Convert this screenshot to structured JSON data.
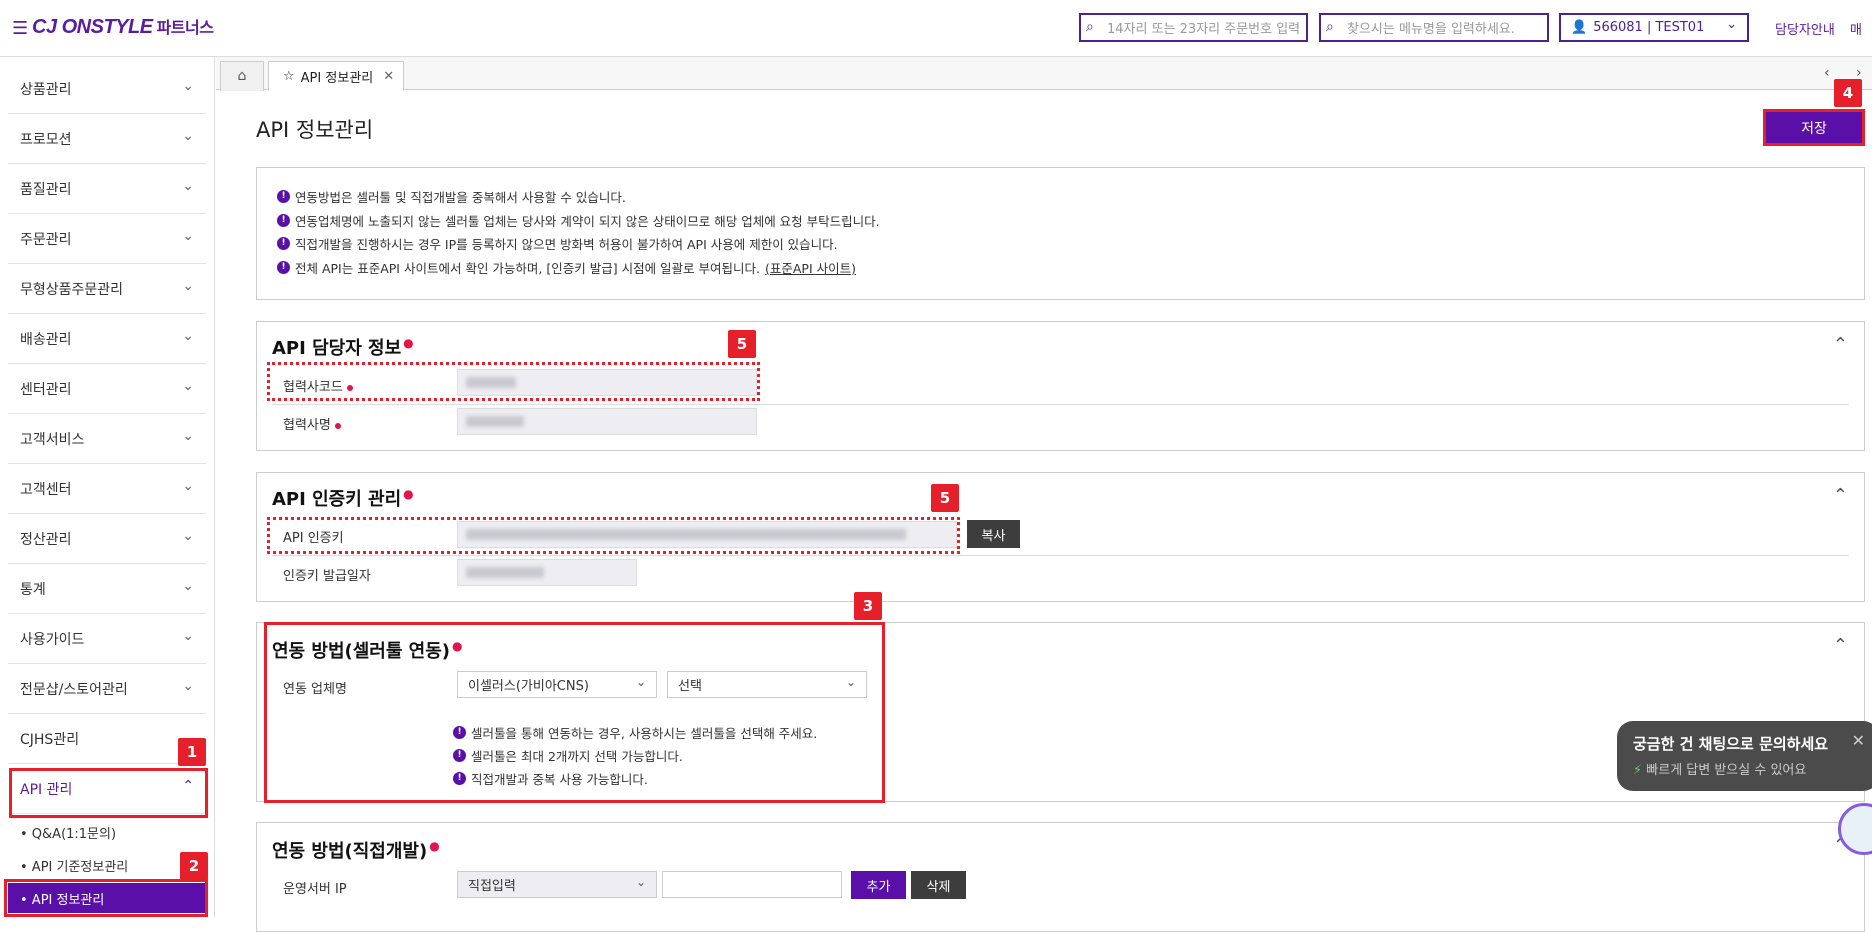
{
  "header": {
    "logo": "CJ ONSTYLE",
    "logo_sub": "파트너스",
    "order_search_placeholder": "14자리 또는 23자리 주문번호 입력",
    "menu_search_placeholder": "찾으시는 메뉴명을 입력하세요.",
    "user": "566081 | TEST01",
    "contact_link": "담당자안내",
    "extra_link": "매"
  },
  "sidebar": {
    "items": [
      {
        "label": "상품관리"
      },
      {
        "label": "프로모션"
      },
      {
        "label": "품질관리"
      },
      {
        "label": "주문관리"
      },
      {
        "label": "무형상품주문관리"
      },
      {
        "label": "배송관리"
      },
      {
        "label": "센터관리"
      },
      {
        "label": "고객서비스"
      },
      {
        "label": "고객센터"
      },
      {
        "label": "정산관리"
      },
      {
        "label": "통계"
      },
      {
        "label": "사용가이드"
      },
      {
        "label": "전문샵/스토어관리"
      },
      {
        "label": "CJHS관리"
      },
      {
        "label": "API 관리"
      }
    ],
    "sub_items": [
      {
        "label": "• Q&A(1:1문의)"
      },
      {
        "label": "• API 기준정보관리"
      },
      {
        "label": "• API 정보관리"
      }
    ]
  },
  "tabs": {
    "active_label": "API 정보관리"
  },
  "page": {
    "title": "API 정보관리",
    "save_label": "저장"
  },
  "notices": {
    "line1": "연동방법은 셀러툴 및 직접개발을 중복해서 사용할 수 있습니다.",
    "line2": "연동업체명에 노출되지 않는 셀러툴 업체는 당사와 계약이 되지 않은 상태이므로 해당 업체에 요청 부탁드립니다.",
    "line3": "직접개발을 진행하시는 경우 IP를 등록하지 않으면 방화벽 허용이 불가하여 API 사용에 제한이 있습니다.",
    "line4": "전체 API는 표준API 사이트에서 확인 가능하며, [인증키 발급] 시점에 일괄로 부여됩니다.",
    "line4_link": "(표준API 사이트)"
  },
  "contact_section": {
    "title": "API 담당자 정보",
    "partner_code_label": "협력사코드",
    "partner_name_label": "협력사명"
  },
  "key_section": {
    "title": "API 인증키 관리",
    "key_label": "API 인증키",
    "copy_label": "복사",
    "issue_date_label": "인증키 발급일자"
  },
  "sellertool_section": {
    "title": "연동 방법(셀러툴 연동)",
    "vendor_label": "연동 업체명",
    "vendor_select1": "이셀러스(가비아CNS)",
    "vendor_select2": "선택",
    "note1": "셀러툴을 통해 연동하는 경우, 사용하시는 셀러툴을 선택해 주세요.",
    "note2": "셀러툴은 최대 2개까지 선택 가능합니다.",
    "note3": "직접개발과 중복 사용 가능합니다."
  },
  "direct_section": {
    "title": "연동 방법(직접개발)",
    "server_ip_label": "운영서버 IP",
    "ip_type_select": "직접입력",
    "add_label": "추가",
    "delete_label": "삭제"
  },
  "chat": {
    "title": "궁금한 건 채팅으로 문의하세요",
    "subtitle": "빠르게 답변 받으실 수 있어요"
  },
  "annotations": {
    "b1": "1",
    "b2": "2",
    "b3": "3",
    "b4": "4",
    "b5a": "5",
    "b5b": "5"
  },
  "colors": {
    "brand": "#5a0fa8",
    "highlight": "#e6202a"
  }
}
